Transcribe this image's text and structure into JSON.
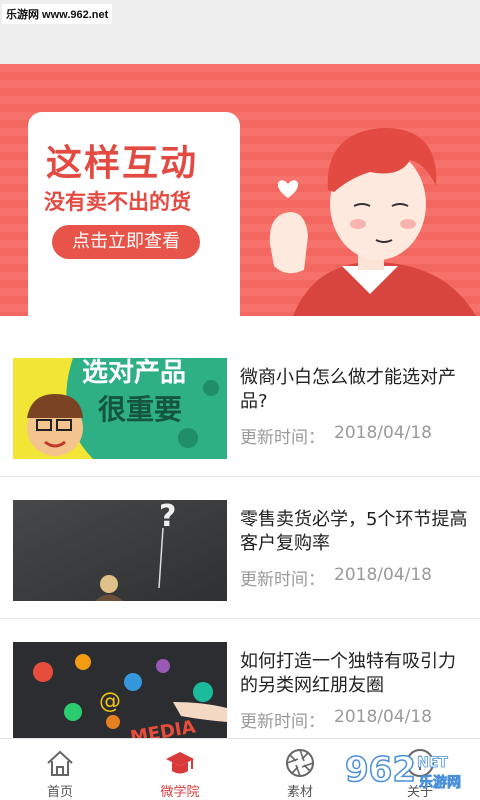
{
  "watermark": {
    "text": "乐游网 www.962.net"
  },
  "banner": {
    "title": "这样互动",
    "subtitle": "没有卖不出的货",
    "button_label": "点击立即查看"
  },
  "articles": [
    {
      "title": "微商小白怎么做才能选对产品?",
      "date_label": "更新时间：",
      "date": "2018/04/18",
      "thumb_text_1": "选对产品",
      "thumb_text_2": "很重要"
    },
    {
      "title": "零售卖货必学，5个环节提高客户复购率",
      "date_label": "更新时间：",
      "date": "2018/04/18"
    },
    {
      "title": "如何打造一个独特有吸引力的另类网红朋友圈",
      "date_label": "更新时间：",
      "date": "2018/04/18",
      "thumb_text_1": "MEDIA"
    }
  ],
  "tabs": [
    {
      "label": "首页",
      "icon": "home-icon"
    },
    {
      "label": "微学院",
      "icon": "graduation-cap-icon",
      "active": true
    },
    {
      "label": "素材",
      "icon": "aperture-icon"
    },
    {
      "label": "关于",
      "icon": "info-icon"
    }
  ],
  "colors": {
    "accent": "#d83a3a",
    "banner": "#f26760"
  },
  "logo_watermark": {
    "text": "962",
    "sub": "乐游网",
    "suffix": "NET"
  }
}
